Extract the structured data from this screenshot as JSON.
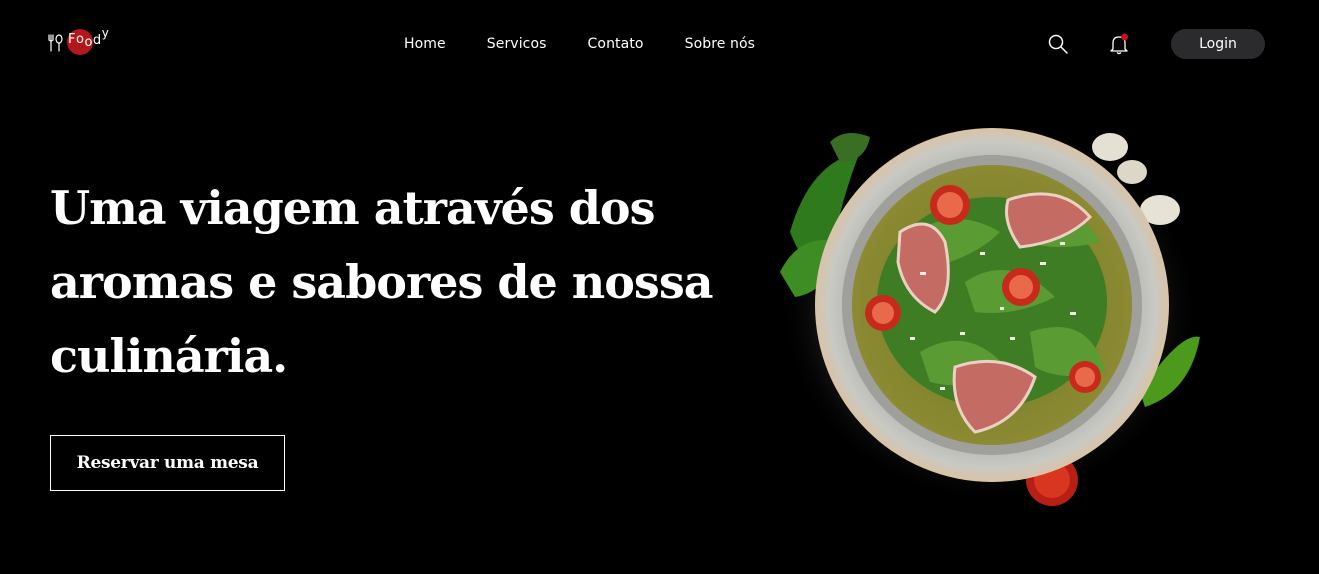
{
  "header": {
    "logo": {
      "letters": [
        "F",
        "o",
        "o",
        "d",
        "y"
      ]
    },
    "nav": [
      "Home",
      "Servicos",
      "Contato",
      "Sobre nós"
    ],
    "actions": {
      "search_icon": "search-icon",
      "bell_icon": "bell-icon",
      "login_label": "Login"
    },
    "colors": {
      "brand_red": "#b3171b",
      "login_bg": "#2b2b2e",
      "background": "#000000"
    }
  },
  "hero": {
    "title": "Uma viagem através dos aromas e sabores de nossa culinária.",
    "cta_label": "Reservar uma mesa"
  }
}
